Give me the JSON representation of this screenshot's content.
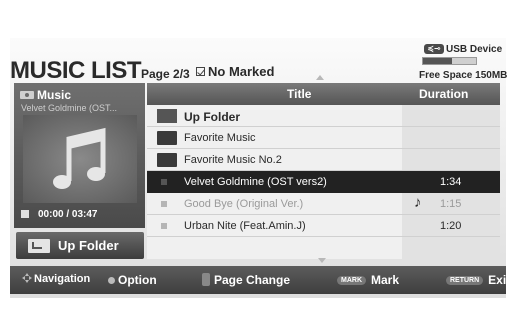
{
  "header": {
    "title": "MUSIC LIST",
    "page_info": "Page 2/3",
    "marked": "No Marked"
  },
  "usb": {
    "device": "USB Device",
    "icon_text": "≼⊸",
    "free_space": "Free Space 150MB",
    "used_fraction": 0.55
  },
  "now_playing": {
    "label": "Music",
    "track": "Velvet Goldmine (OST...",
    "time": "00:00 / 03:47"
  },
  "up_folder_button": "Up Folder",
  "list": {
    "col_title": "Title",
    "col_duration": "Duration",
    "rows": [
      {
        "type": "up",
        "name": "Up Folder",
        "duration": ""
      },
      {
        "type": "folder",
        "name": "Favorite Music",
        "duration": ""
      },
      {
        "type": "folder",
        "name": "Favorite Music No.2",
        "duration": ""
      },
      {
        "type": "file",
        "name": "Velvet Goldmine (OST vers2)",
        "duration": "1:34",
        "selected": true
      },
      {
        "type": "file",
        "name": "Good Bye (Original Ver.)",
        "duration": "1:15",
        "dimmed": true,
        "playing": true
      },
      {
        "type": "file",
        "name": "Urban Nite (Feat.Amin.J)",
        "duration": "1:20"
      }
    ]
  },
  "footer": {
    "navigation": "Navigation",
    "option": "Option",
    "page_change": "Page Change",
    "mark_key": "MARK",
    "mark": "Mark",
    "return_key": "RETURN",
    "exit": "Exit"
  },
  "colors": {
    "selected_row": "#222222",
    "header_bar": "#555555",
    "footer_bar": "#4a4a4a"
  }
}
